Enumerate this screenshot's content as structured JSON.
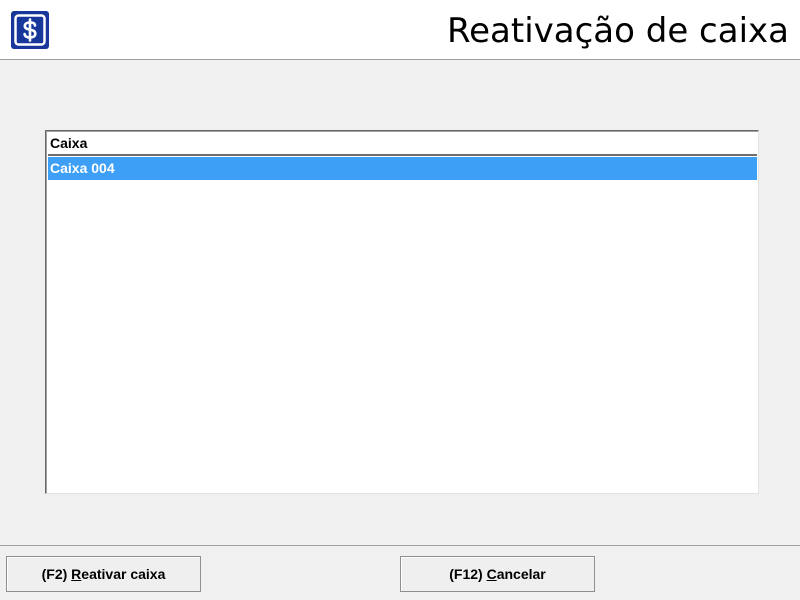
{
  "header": {
    "title": "Reativação de caixa",
    "logo_icon": "dollar-sign-icon"
  },
  "list": {
    "column_header": "Caixa",
    "rows": [
      "Caixa 004"
    ],
    "selected_row": 0
  },
  "buttons": {
    "reativar": {
      "prefix": "(F2) ",
      "mnemonic": "R",
      "rest": "eativar caixa"
    },
    "cancelar": {
      "prefix": "(F12) ",
      "mnemonic": "C",
      "rest": "ancelar"
    }
  },
  "colors": {
    "logo_bg": "#17379a",
    "selection": "#3d9ff5",
    "window_bg": "#f0f0f0"
  }
}
